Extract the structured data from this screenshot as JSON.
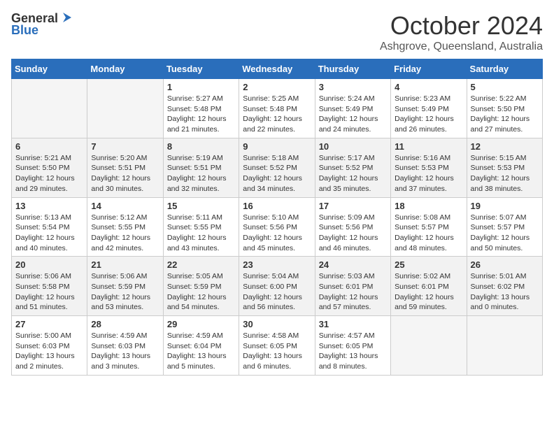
{
  "header": {
    "logo_general": "General",
    "logo_blue": "Blue",
    "month": "October 2024",
    "location": "Ashgrove, Queensland, Australia"
  },
  "weekdays": [
    "Sunday",
    "Monday",
    "Tuesday",
    "Wednesday",
    "Thursday",
    "Friday",
    "Saturday"
  ],
  "weeks": [
    [
      {
        "day": "",
        "empty": true
      },
      {
        "day": "",
        "empty": true
      },
      {
        "day": "1",
        "sunrise": "5:27 AM",
        "sunset": "5:48 PM",
        "daylight": "12 hours and 21 minutes."
      },
      {
        "day": "2",
        "sunrise": "5:25 AM",
        "sunset": "5:48 PM",
        "daylight": "12 hours and 22 minutes."
      },
      {
        "day": "3",
        "sunrise": "5:24 AM",
        "sunset": "5:49 PM",
        "daylight": "12 hours and 24 minutes."
      },
      {
        "day": "4",
        "sunrise": "5:23 AM",
        "sunset": "5:49 PM",
        "daylight": "12 hours and 26 minutes."
      },
      {
        "day": "5",
        "sunrise": "5:22 AM",
        "sunset": "5:50 PM",
        "daylight": "12 hours and 27 minutes."
      }
    ],
    [
      {
        "day": "6",
        "sunrise": "5:21 AM",
        "sunset": "5:50 PM",
        "daylight": "12 hours and 29 minutes."
      },
      {
        "day": "7",
        "sunrise": "5:20 AM",
        "sunset": "5:51 PM",
        "daylight": "12 hours and 30 minutes."
      },
      {
        "day": "8",
        "sunrise": "5:19 AM",
        "sunset": "5:51 PM",
        "daylight": "12 hours and 32 minutes."
      },
      {
        "day": "9",
        "sunrise": "5:18 AM",
        "sunset": "5:52 PM",
        "daylight": "12 hours and 34 minutes."
      },
      {
        "day": "10",
        "sunrise": "5:17 AM",
        "sunset": "5:52 PM",
        "daylight": "12 hours and 35 minutes."
      },
      {
        "day": "11",
        "sunrise": "5:16 AM",
        "sunset": "5:53 PM",
        "daylight": "12 hours and 37 minutes."
      },
      {
        "day": "12",
        "sunrise": "5:15 AM",
        "sunset": "5:53 PM",
        "daylight": "12 hours and 38 minutes."
      }
    ],
    [
      {
        "day": "13",
        "sunrise": "5:13 AM",
        "sunset": "5:54 PM",
        "daylight": "12 hours and 40 minutes."
      },
      {
        "day": "14",
        "sunrise": "5:12 AM",
        "sunset": "5:55 PM",
        "daylight": "12 hours and 42 minutes."
      },
      {
        "day": "15",
        "sunrise": "5:11 AM",
        "sunset": "5:55 PM",
        "daylight": "12 hours and 43 minutes."
      },
      {
        "day": "16",
        "sunrise": "5:10 AM",
        "sunset": "5:56 PM",
        "daylight": "12 hours and 45 minutes."
      },
      {
        "day": "17",
        "sunrise": "5:09 AM",
        "sunset": "5:56 PM",
        "daylight": "12 hours and 46 minutes."
      },
      {
        "day": "18",
        "sunrise": "5:08 AM",
        "sunset": "5:57 PM",
        "daylight": "12 hours and 48 minutes."
      },
      {
        "day": "19",
        "sunrise": "5:07 AM",
        "sunset": "5:57 PM",
        "daylight": "12 hours and 50 minutes."
      }
    ],
    [
      {
        "day": "20",
        "sunrise": "5:06 AM",
        "sunset": "5:58 PM",
        "daylight": "12 hours and 51 minutes."
      },
      {
        "day": "21",
        "sunrise": "5:06 AM",
        "sunset": "5:59 PM",
        "daylight": "12 hours and 53 minutes."
      },
      {
        "day": "22",
        "sunrise": "5:05 AM",
        "sunset": "5:59 PM",
        "daylight": "12 hours and 54 minutes."
      },
      {
        "day": "23",
        "sunrise": "5:04 AM",
        "sunset": "6:00 PM",
        "daylight": "12 hours and 56 minutes."
      },
      {
        "day": "24",
        "sunrise": "5:03 AM",
        "sunset": "6:01 PM",
        "daylight": "12 hours and 57 minutes."
      },
      {
        "day": "25",
        "sunrise": "5:02 AM",
        "sunset": "6:01 PM",
        "daylight": "12 hours and 59 minutes."
      },
      {
        "day": "26",
        "sunrise": "5:01 AM",
        "sunset": "6:02 PM",
        "daylight": "13 hours and 0 minutes."
      }
    ],
    [
      {
        "day": "27",
        "sunrise": "5:00 AM",
        "sunset": "6:03 PM",
        "daylight": "13 hours and 2 minutes."
      },
      {
        "day": "28",
        "sunrise": "4:59 AM",
        "sunset": "6:03 PM",
        "daylight": "13 hours and 3 minutes."
      },
      {
        "day": "29",
        "sunrise": "4:59 AM",
        "sunset": "6:04 PM",
        "daylight": "13 hours and 5 minutes."
      },
      {
        "day": "30",
        "sunrise": "4:58 AM",
        "sunset": "6:05 PM",
        "daylight": "13 hours and 6 minutes."
      },
      {
        "day": "31",
        "sunrise": "4:57 AM",
        "sunset": "6:05 PM",
        "daylight": "13 hours and 8 minutes."
      },
      {
        "day": "",
        "empty": true
      },
      {
        "day": "",
        "empty": true
      }
    ]
  ],
  "labels": {
    "sunrise": "Sunrise:",
    "sunset": "Sunset:",
    "daylight": "Daylight:"
  }
}
